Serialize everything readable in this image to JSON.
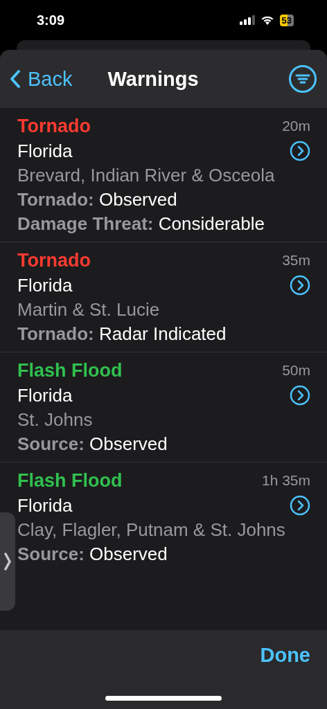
{
  "status_bar": {
    "time": "3:09",
    "battery": "53"
  },
  "nav": {
    "back": "Back",
    "title": "Warnings"
  },
  "warnings": [
    {
      "title": "Tornado",
      "color": "#ff3b30",
      "age": "20m",
      "state": "Florida",
      "counties": "Brevard, Indian River & Osceola",
      "details": [
        {
          "label": "Tornado:",
          "value": "Observed"
        },
        {
          "label": "Damage Threat:",
          "value": "Considerable"
        }
      ]
    },
    {
      "title": "Tornado",
      "color": "#ff3b30",
      "age": "35m",
      "state": "Florida",
      "counties": "Martin & St. Lucie",
      "details": [
        {
          "label": "Tornado:",
          "value": "Radar Indicated"
        }
      ]
    },
    {
      "title": "Flash Flood",
      "color": "#30c04f",
      "age": "50m",
      "state": "Florida",
      "counties": "St. Johns",
      "details": [
        {
          "label": "Source:",
          "value": "Observed"
        }
      ]
    },
    {
      "title": "Flash Flood",
      "color": "#30c04f",
      "age": "1h 35m",
      "state": "Florida",
      "counties": "Clay, Flagler, Putnam & St. Johns",
      "details": [
        {
          "label": "Source:",
          "value": "Observed"
        }
      ]
    }
  ],
  "done": "Done"
}
